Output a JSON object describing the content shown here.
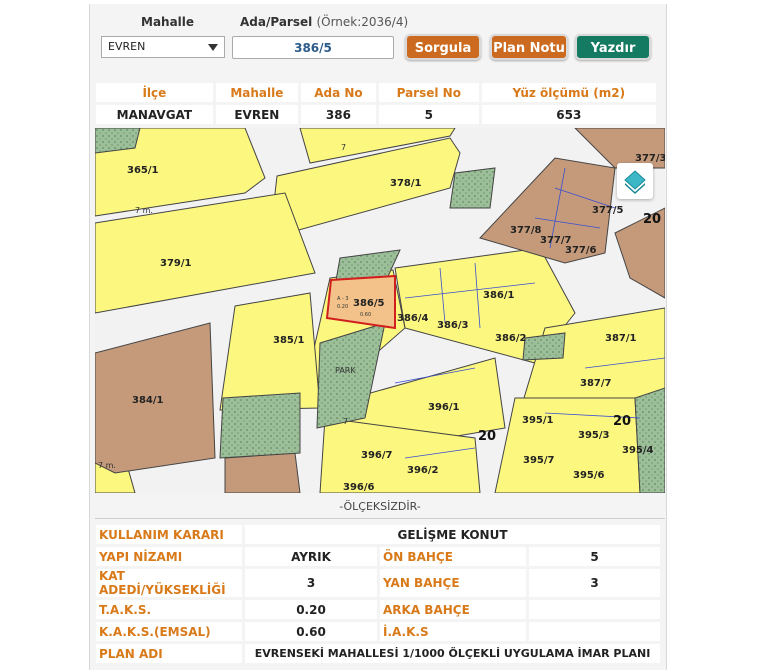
{
  "search": {
    "mahalle_label": "Mahalle",
    "ada_label": "Ada/Parsel",
    "ada_example": "(Örnek:2036/4)",
    "mahalle_value": "EVREN",
    "ada_value": "386/5"
  },
  "buttons": {
    "sorgula": "Sorgula",
    "plan_notu": "Plan Notu",
    "yazdir": "Yazdır"
  },
  "summary": {
    "headers": [
      "İlçe",
      "Mahalle",
      "Ada No",
      "Parsel No",
      "Yüz ölçümü (m2)"
    ],
    "values": [
      "MANAVGAT",
      "EVREN",
      "386",
      "5",
      "653"
    ]
  },
  "map": {
    "parcels": [
      "365/1",
      "378/1",
      "379/1",
      "384/1",
      "385/1",
      "386/5",
      "386/4",
      "386/3",
      "386/1",
      "386/2",
      "396/1",
      "396/7",
      "396/2",
      "396/6",
      "377/3",
      "377/5",
      "377/8",
      "377/7",
      "377/6",
      "387/1",
      "387/7",
      "395/1",
      "395/3",
      "395/7",
      "395/4",
      "395/6"
    ],
    "block_numbers": [
      "20",
      "20",
      "20"
    ],
    "zoning_codes": [
      "A - 3",
      "0.20",
      "0.60"
    ],
    "street_labels": [
      "7 m.",
      "7",
      "7",
      "7 m."
    ],
    "park_label": "PARK",
    "selected_parcel": "386/5",
    "colors": {
      "residential": "#fbf77f",
      "commercial": "#c49a7b",
      "park": "#9cbf9a",
      "road": "#f2f2f2",
      "selected": "#f3c28a",
      "selected_border": "#d11e1e"
    }
  },
  "scale_text": "-ÖLÇEKSİZDİR-",
  "attributes": {
    "kullanim_label": "KULLANIM KARARI",
    "kullanim_value": "GELİŞME KONUT",
    "yapi_label": "YAPI NİZAMI",
    "yapi_value": "AYRIK",
    "on_bahce_label": "ÖN BAHÇE",
    "on_bahce_value": "5",
    "kat_label": "KAT ADEDİ/YÜKSEKLİĞİ",
    "kat_value": "3",
    "yan_bahce_label": "YAN BAHÇE",
    "yan_bahce_value": "3",
    "taks_label": "T.A.K.S.",
    "taks_value": "0.20",
    "arka_bahce_label": "ARKA BAHÇE",
    "arka_bahce_value": "",
    "kaks_label": "K.A.K.S.(EMSAL)",
    "kaks_value": "0.60",
    "iaks_label": "İ.A.K.S",
    "iaks_value": "",
    "plan_label": "PLAN ADI",
    "plan_value": "EVRENSEKİ MAHALLESİ 1/1000 ÖLÇEKLİ UYGULAMA İMAR PLANI"
  }
}
